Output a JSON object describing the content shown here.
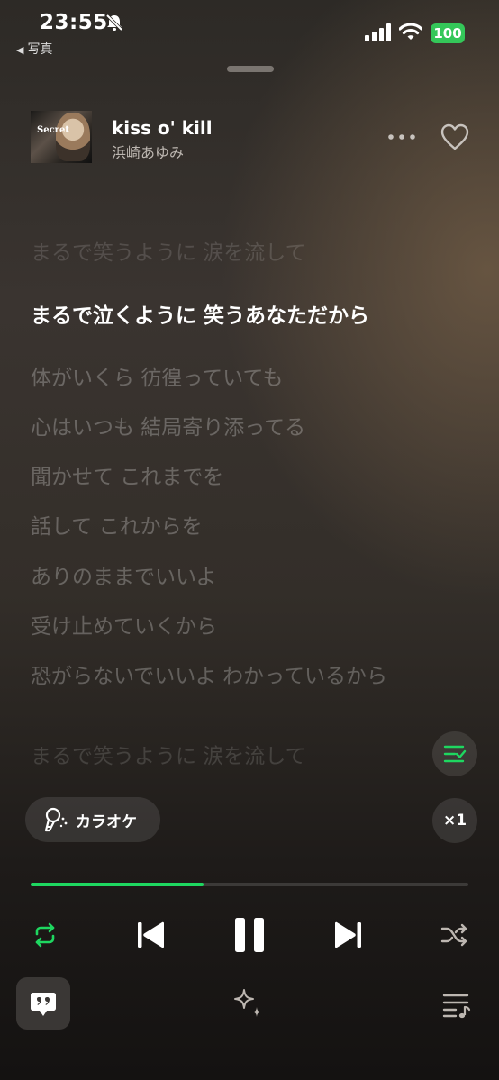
{
  "status_bar": {
    "time": "23:55",
    "back_label": "写真",
    "battery": "100"
  },
  "track": {
    "title": "kiss o' kill",
    "artist": "浜崎あゆみ",
    "album_art_text": "Secret"
  },
  "lyrics": [
    {
      "text": "まるで笑うように 涙を流して",
      "state": "past"
    },
    {
      "text": "まるで泣くように 笑うあなただから",
      "state": "active"
    },
    {
      "text": "体がいくら 彷徨っていても",
      "state": "upcoming"
    },
    {
      "text": "心はいつも 結局寄り添ってる",
      "state": "upcoming"
    },
    {
      "text": "聞かせて これまでを",
      "state": "upcoming"
    },
    {
      "text": "話して これからを",
      "state": "upcoming"
    },
    {
      "text": "ありのままでいいよ",
      "state": "upcoming"
    },
    {
      "text": "受け止めていくから",
      "state": "upcoming"
    },
    {
      "text": "恐がらないでいいよ わかっているから",
      "state": "upcoming"
    },
    {
      "text": "まるで笑うように 涙を流して",
      "state": "upcoming"
    }
  ],
  "karaoke_label": "カラオケ",
  "speed_label": "×1",
  "playback": {
    "progress": 0.395
  },
  "colors": {
    "accent": "#1ed760",
    "battery": "#34c759"
  }
}
